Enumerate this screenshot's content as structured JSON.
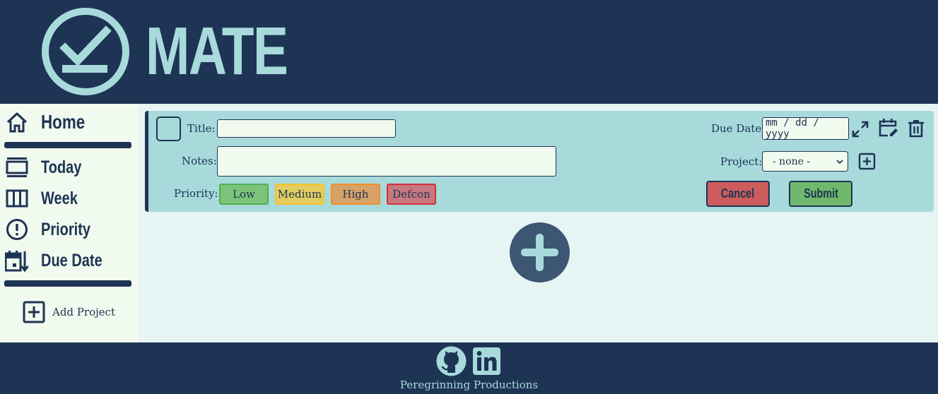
{
  "app": {
    "title": "MATE"
  },
  "sidebar": {
    "items": [
      {
        "label": "Home",
        "icon": "home-icon"
      },
      {
        "label": "Today",
        "icon": "today-icon"
      },
      {
        "label": "Week",
        "icon": "week-icon"
      },
      {
        "label": "Priority",
        "icon": "priority-icon"
      },
      {
        "label": "Due Date",
        "icon": "due-date-sort-icon"
      }
    ],
    "add_project_label": "Add Project"
  },
  "task_form": {
    "title_label": "Title:",
    "title_value": "",
    "notes_label": "Notes:",
    "notes_value": "",
    "priority_label": "Priority:",
    "priorities": [
      "Low",
      "Medium",
      "High",
      "Defcon"
    ],
    "due_date_label": "Due Date:",
    "due_date_placeholder": "mm / dd / yyyy",
    "project_label": "Project:",
    "project_selected": "- none -",
    "cancel_label": "Cancel",
    "submit_label": "Submit"
  },
  "footer": {
    "credit": "Peregrinning Productions"
  },
  "colors": {
    "navy": "#1e3455",
    "teal": "#a8dadc",
    "cream": "#f1faee",
    "background": "#e6f4f3",
    "low": "#7cc47a",
    "medium": "#e3cd5e",
    "high": "#d6a267",
    "defcon": "#c7787e",
    "cancel": "#cd5c5c",
    "submit": "#6fb86c"
  }
}
